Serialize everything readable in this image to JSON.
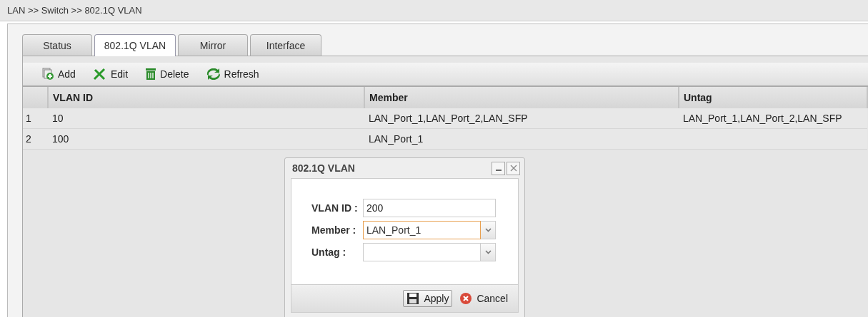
{
  "breadcrumb": "LAN >> Switch >> 802.1Q VLAN",
  "tabs": [
    {
      "label": "Status",
      "selected": false
    },
    {
      "label": "802.1Q VLAN",
      "selected": true
    },
    {
      "label": "Mirror",
      "selected": false
    },
    {
      "label": "Interface",
      "selected": false
    }
  ],
  "toolbar": [
    {
      "kind": "add",
      "label": "Add"
    },
    {
      "kind": "edit",
      "label": "Edit"
    },
    {
      "kind": "delete",
      "label": "Delete"
    },
    {
      "kind": "refresh",
      "label": "Refresh"
    }
  ],
  "table": {
    "columns": [
      "VLAN ID",
      "Member",
      "Untag"
    ],
    "rows": [
      {
        "number": "1",
        "cells": [
          "10",
          "LAN_Port_1,LAN_Port_2,LAN_SFP",
          "LAN_Port_1,LAN_Port_2,LAN_SFP"
        ]
      },
      {
        "number": "2",
        "cells": [
          "100",
          "LAN_Port_1",
          ""
        ]
      }
    ]
  },
  "dialog": {
    "title": "802.1Q VLAN",
    "fields": [
      {
        "kind": "text",
        "label": "VLAN ID :",
        "value": "200",
        "focused": false
      },
      {
        "kind": "combo",
        "label": "Member :",
        "value": "LAN_Port_1",
        "focused": true
      },
      {
        "kind": "combo",
        "label": "Untag :",
        "focused": false
      }
    ],
    "buttons": [
      {
        "kind": "apply",
        "label": "Apply"
      },
      {
        "kind": "cancel",
        "label": "Cancel"
      }
    ]
  }
}
